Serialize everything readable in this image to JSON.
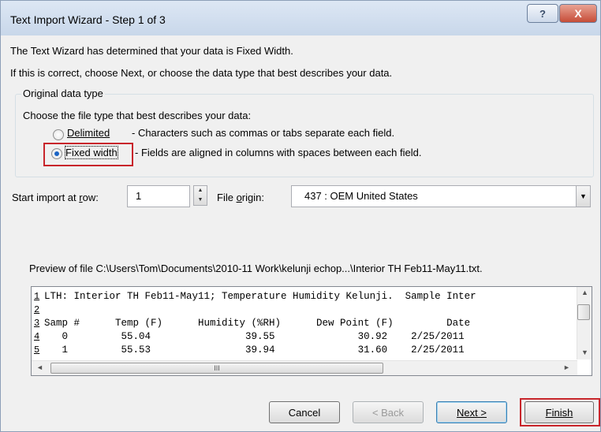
{
  "window": {
    "title": "Text Import Wizard - Step 1 of 3",
    "help_label": "?",
    "close_label": "X"
  },
  "intro": {
    "line1": "The Text Wizard has determined that your data is Fixed Width.",
    "line2": "If this is correct, choose Next, or choose the data type that best describes your data."
  },
  "group": {
    "legend": "Original data type",
    "prompt": "Choose the file type that best describes your data:",
    "options": [
      {
        "label": "Delimited",
        "description": "- Characters such as commas or tabs separate each field.",
        "selected": false
      },
      {
        "label": "Fixed width",
        "description": "- Fields are aligned in columns with spaces between each field.",
        "selected": true
      }
    ]
  },
  "import_row": {
    "label_pre": "Start import at ",
    "label_key": "r",
    "label_post": "ow:",
    "value": "1"
  },
  "file_origin": {
    "label_pre": "File ",
    "label_key": "o",
    "label_post": "rigin:",
    "value": "437 : OEM United States"
  },
  "preview": {
    "label": "Preview of file C:\\Users\\Tom\\Documents\\2010-11 Work\\kelunji echop...\\Interior TH Feb11-May11.txt.",
    "rows": [
      {
        "num": "1",
        "text": "LTH: Interior TH Feb11-May11; Temperature Humidity Kelunji.  Sample Inter"
      },
      {
        "num": "2",
        "text": ""
      },
      {
        "num": "3",
        "text": "Samp #      Temp (F)      Humidity (%RH)      Dew Point (F)         Date"
      },
      {
        "num": "4",
        "text": "   0         55.04                39.55              30.92    2/25/2011"
      },
      {
        "num": "5",
        "text": "   1         55.53                39.94              31.60    2/25/2011"
      }
    ],
    "hscroll_grip": "III"
  },
  "buttons": {
    "cancel": "Cancel",
    "back": "< Back",
    "next": "Next >",
    "finish": "Finish"
  },
  "icons": {
    "up": "▲",
    "down": "▼",
    "left": "◄",
    "right": "►"
  }
}
